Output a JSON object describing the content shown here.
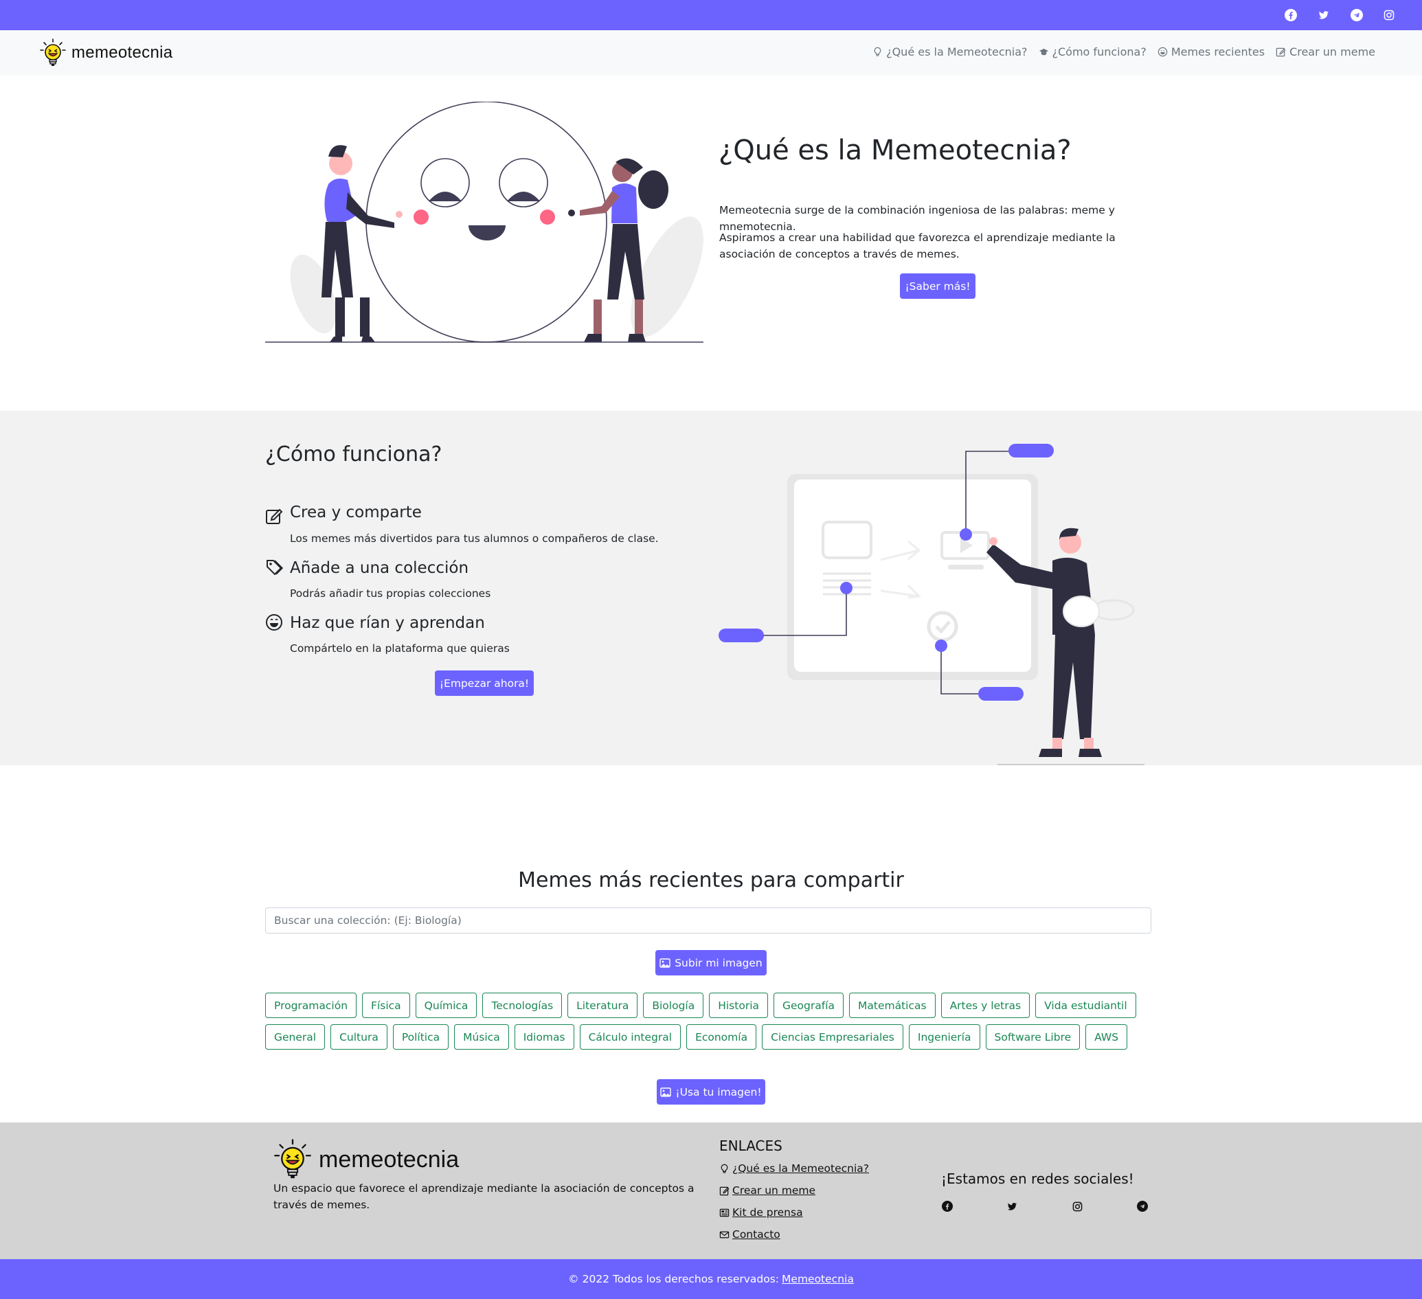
{
  "topbar": {
    "color": "#6c63ff",
    "social_icons": [
      "facebook-icon",
      "twitter-icon",
      "telegram-icon",
      "instagram-icon"
    ]
  },
  "navbar": {
    "brand": "memeotecnia",
    "links": [
      {
        "label": "¿Qué es la Memeotecnia?",
        "icon": "lightbulb-icon"
      },
      {
        "label": "¿Cómo funciona?",
        "icon": "mortarboard-icon"
      },
      {
        "label": "Memes recientes",
        "icon": "smile-icon"
      },
      {
        "label": "Crear un meme",
        "icon": "edit-icon"
      }
    ]
  },
  "hero": {
    "title": "¿Qué es la Memeotecnia?",
    "paragraph1": "Memeotecnia surge de la combinación ingeniosa de las palabras: meme y mnemotecnia.",
    "paragraph2": "Aspiramos a crear una habilidad que favorezca el aprendizaje mediante la asociación de conceptos a través de memes.",
    "button": "¡Saber más!"
  },
  "como": {
    "title": "¿Cómo funciona?",
    "steps": [
      {
        "title": "Crea y comparte",
        "desc": "Los memes más divertidos para tus alumnos o compañeros de clase.",
        "icon": "edit-icon"
      },
      {
        "title": "Añade a una colección",
        "desc": "Podrás añadir tus propias colecciones",
        "icon": "tags-icon"
      },
      {
        "title": "Haz que rían y aprendan",
        "desc": "Compártelo en la plataforma que quieras",
        "icon": "laugh-icon"
      }
    ],
    "button": "¡Empezar ahora!"
  },
  "recent": {
    "title": "Memes más recientes para compartir",
    "search_placeholder": "Buscar una colección: (Ej: Biología)",
    "upload_button": "Subir mi imagen",
    "tags_row1": [
      "Programación",
      "Física",
      "Química",
      "Tecnologías",
      "Literatura",
      "Biología",
      "Historia",
      "Geografía",
      "Matemáticas",
      "Artes y letras",
      "Vida estudiantil"
    ],
    "tags_row2": [
      "General",
      "Cultura",
      "Política",
      "Música",
      "Idiomas",
      "Cálculo integral",
      "Economía",
      "Ciencias Empresariales",
      "Ingeniería",
      "Software Libre",
      "AWS"
    ],
    "use_button": "¡Usa tu imagen!"
  },
  "footer": {
    "brand": "memeotecnia",
    "description": "Un espacio que favorece el aprendizaje mediante la asociación de conceptos a través de memes.",
    "links_heading": "ENLACES",
    "links": [
      {
        "label": "¿Qué es la Memeotecnia?",
        "icon": "lightbulb-icon"
      },
      {
        "label": "Crear un meme",
        "icon": "edit-icon"
      },
      {
        "label": "Kit de prensa",
        "icon": "newspaper-icon"
      },
      {
        "label": "Contacto",
        "icon": "envelope-icon"
      }
    ],
    "social_heading": "¡Estamos en redes sociales!",
    "social_icons": [
      "facebook-icon",
      "twitter-icon",
      "instagram-icon",
      "telegram-icon"
    ],
    "copyright_prefix": "© 2022 Todos los derechos reservados:",
    "copyright_link": "Memeotecnia"
  },
  "colors": {
    "accent": "#6c63ff",
    "tag_green": "#198754",
    "footer_bg": "#d3d3d3",
    "section_bg": "#f2f2f2"
  }
}
